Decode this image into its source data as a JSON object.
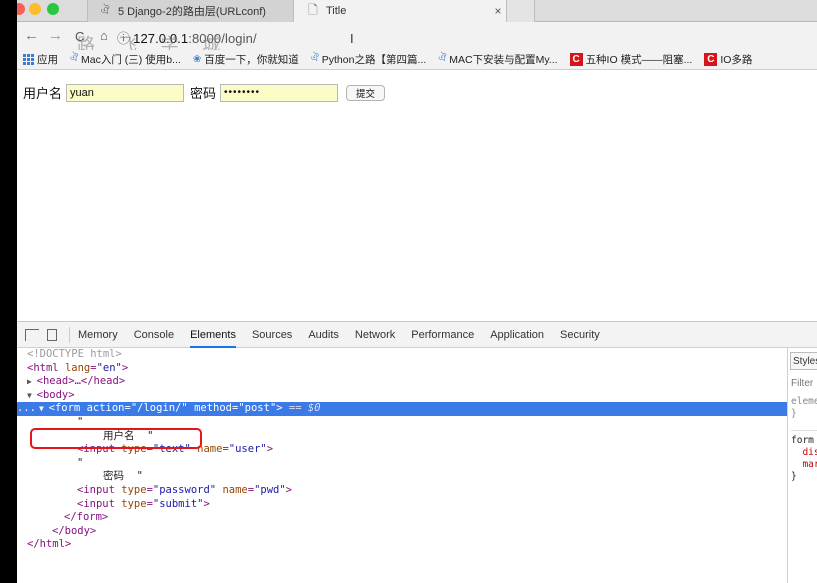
{
  "browser": {
    "tabs": [
      {
        "icon": "django-icon",
        "title": "5 Django-2的路由层(URLconf)"
      },
      {
        "icon": "page-icon",
        "title": "Title"
      }
    ],
    "url_info_icon": "ⓘ",
    "url_host": "127.0.0.1",
    "url_rest": ":8000/login/",
    "watermark": "路 飞 学 城",
    "bookmarks": [
      {
        "icon": "apps-icon",
        "label": "应用"
      },
      {
        "icon": "django-icon",
        "label": "Mac入门 (三) 使用b..."
      },
      {
        "icon": "baidu-icon",
        "label": "百度一下，你就知道"
      },
      {
        "icon": "django-icon",
        "label": "Python之路【第四篇..."
      },
      {
        "icon": "django-icon",
        "label": "MAC下安装与配置My..."
      },
      {
        "icon": "csdn-icon",
        "label": "五种IO 模式——阻塞..."
      },
      {
        "icon": "csdn-icon",
        "label": "IO多路"
      }
    ]
  },
  "page": {
    "user_label": "用户名",
    "user_value": "yuan",
    "pwd_label": "密码",
    "pwd_value": "••••••••",
    "submit_label": "提交"
  },
  "devtools": {
    "tabs": [
      "Memory",
      "Console",
      "Elements",
      "Sources",
      "Audits",
      "Network",
      "Performance",
      "Application",
      "Security"
    ],
    "active_tab": "Elements",
    "dom": {
      "doctype": "<!DOCTYPE html>",
      "html_open": "<html ",
      "lang_attr": "lang",
      "lang_val": "\"en\"",
      "head": "<head>…</head>",
      "body_open": "<body>",
      "form_open": "<form ",
      "action_attr": "action",
      "action_val": "\"/login/\"",
      "method_attr": "method",
      "method_val": "\"post\"",
      "form_close_gt": ">",
      "eq_var": " == $0",
      "quote": "\"",
      "text_user": "用户名  \"",
      "input_open": "<input ",
      "type_attr": "type",
      "name_attr": "name",
      "text_val": "\"text\"",
      "user_val": "\"user\"",
      "text_pwd": "密码  \"",
      "password_val": "\"password\"",
      "pwd_val": "\"pwd\"",
      "submit_val": "\"submit\"",
      "gt": ">",
      "form_close": "</form>",
      "body_close": "</body>",
      "html_close": "</html>",
      "ellipsis": "..."
    },
    "styles_pane": {
      "tab": "Styles",
      "filter": "Filter",
      "rule1": "element.style {\n}",
      "rule2_selector": "form {",
      "rule2_p1": "display",
      "rule2_p2": "margin",
      "rule2_end": "}"
    }
  }
}
